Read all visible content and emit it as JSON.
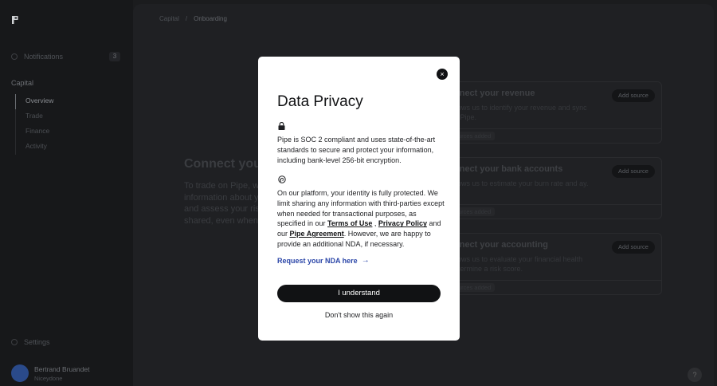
{
  "sidebar": {
    "notifications": {
      "label": "Notifications",
      "count": "3"
    },
    "section_title": "Capital",
    "items": [
      {
        "label": "Overview"
      },
      {
        "label": "Trade"
      },
      {
        "label": "Finance"
      },
      {
        "label": "Activity"
      }
    ],
    "settings_label": "Settings",
    "user": {
      "name": "Bertrand Bruandet",
      "org": "Niceydone"
    }
  },
  "breadcrumb": {
    "root": "Capital",
    "separator": "/",
    "current": "Onboarding"
  },
  "main": {
    "title": "Connect your",
    "desc_lines": [
      "To trade on Pipe, we",
      "information about yo",
      "and assess your risk",
      "shared, even when y"
    ]
  },
  "cards": [
    {
      "title": "nnect your revenue",
      "desc": "llows us to identify your revenue and sync n Pipe.",
      "button": "Add source",
      "foot": "urces added"
    },
    {
      "title": "nnect your bank accounts",
      "desc": "llows us to estimate your burn rate and ay.",
      "button": "Add source",
      "foot": "urces added"
    },
    {
      "title": "nnect your accounting",
      "desc": "llows us to evaluate your financial health etermine a risk score.",
      "button": "Add source",
      "foot": "urces added"
    }
  ],
  "modal": {
    "title": "Data Privacy",
    "close": "×",
    "p1": "Pipe is SOC 2 compliant and uses state-of-the-art standards to secure and protect your information, including bank-level 256-bit encryption.",
    "p2_a": "On our platform, your identity is fully protected. We limit sharing any information with third-parties except when needed for transactional purposes, as specified in our ",
    "terms": "Terms of Use",
    "p2_comma": " , ",
    "privacy": "Privacy Policy",
    "p2_and": " and our ",
    "pipe_agreement": "Pipe Agreement",
    "p2_b": ". However, we are happy to provide an additional NDA, if necessary.",
    "nda_link": "Request your NDA here",
    "nda_arrow": "→",
    "understand": "I understand",
    "dont_show": "Don't show this again"
  },
  "help": "?",
  "colors": {
    "accent_link": "#2b46a8",
    "dark": "#111214"
  }
}
